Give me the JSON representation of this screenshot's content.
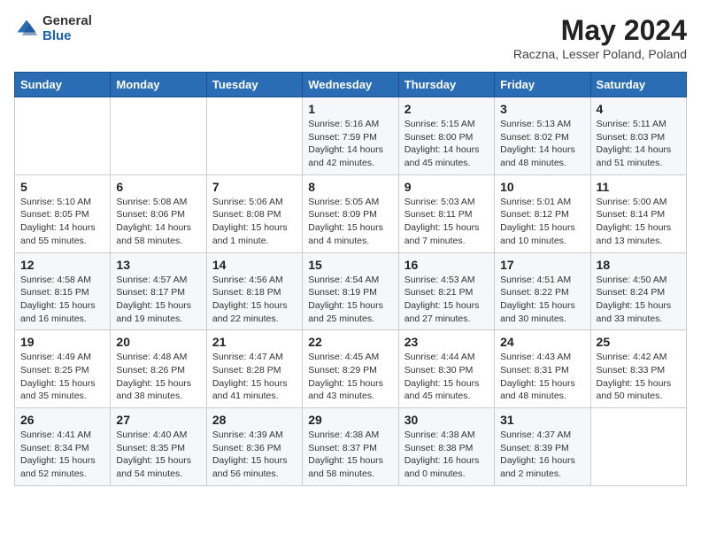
{
  "logo": {
    "general": "General",
    "blue": "Blue"
  },
  "title": "May 2024",
  "subtitle": "Raczna, Lesser Poland, Poland",
  "headers": [
    "Sunday",
    "Monday",
    "Tuesday",
    "Wednesday",
    "Thursday",
    "Friday",
    "Saturday"
  ],
  "weeks": [
    [
      {
        "day": "",
        "info": ""
      },
      {
        "day": "",
        "info": ""
      },
      {
        "day": "",
        "info": ""
      },
      {
        "day": "1",
        "info": "Sunrise: 5:16 AM\nSunset: 7:59 PM\nDaylight: 14 hours\nand 42 minutes."
      },
      {
        "day": "2",
        "info": "Sunrise: 5:15 AM\nSunset: 8:00 PM\nDaylight: 14 hours\nand 45 minutes."
      },
      {
        "day": "3",
        "info": "Sunrise: 5:13 AM\nSunset: 8:02 PM\nDaylight: 14 hours\nand 48 minutes."
      },
      {
        "day": "4",
        "info": "Sunrise: 5:11 AM\nSunset: 8:03 PM\nDaylight: 14 hours\nand 51 minutes."
      }
    ],
    [
      {
        "day": "5",
        "info": "Sunrise: 5:10 AM\nSunset: 8:05 PM\nDaylight: 14 hours\nand 55 minutes."
      },
      {
        "day": "6",
        "info": "Sunrise: 5:08 AM\nSunset: 8:06 PM\nDaylight: 14 hours\nand 58 minutes."
      },
      {
        "day": "7",
        "info": "Sunrise: 5:06 AM\nSunset: 8:08 PM\nDaylight: 15 hours\nand 1 minute."
      },
      {
        "day": "8",
        "info": "Sunrise: 5:05 AM\nSunset: 8:09 PM\nDaylight: 15 hours\nand 4 minutes."
      },
      {
        "day": "9",
        "info": "Sunrise: 5:03 AM\nSunset: 8:11 PM\nDaylight: 15 hours\nand 7 minutes."
      },
      {
        "day": "10",
        "info": "Sunrise: 5:01 AM\nSunset: 8:12 PM\nDaylight: 15 hours\nand 10 minutes."
      },
      {
        "day": "11",
        "info": "Sunrise: 5:00 AM\nSunset: 8:14 PM\nDaylight: 15 hours\nand 13 minutes."
      }
    ],
    [
      {
        "day": "12",
        "info": "Sunrise: 4:58 AM\nSunset: 8:15 PM\nDaylight: 15 hours\nand 16 minutes."
      },
      {
        "day": "13",
        "info": "Sunrise: 4:57 AM\nSunset: 8:17 PM\nDaylight: 15 hours\nand 19 minutes."
      },
      {
        "day": "14",
        "info": "Sunrise: 4:56 AM\nSunset: 8:18 PM\nDaylight: 15 hours\nand 22 minutes."
      },
      {
        "day": "15",
        "info": "Sunrise: 4:54 AM\nSunset: 8:19 PM\nDaylight: 15 hours\nand 25 minutes."
      },
      {
        "day": "16",
        "info": "Sunrise: 4:53 AM\nSunset: 8:21 PM\nDaylight: 15 hours\nand 27 minutes."
      },
      {
        "day": "17",
        "info": "Sunrise: 4:51 AM\nSunset: 8:22 PM\nDaylight: 15 hours\nand 30 minutes."
      },
      {
        "day": "18",
        "info": "Sunrise: 4:50 AM\nSunset: 8:24 PM\nDaylight: 15 hours\nand 33 minutes."
      }
    ],
    [
      {
        "day": "19",
        "info": "Sunrise: 4:49 AM\nSunset: 8:25 PM\nDaylight: 15 hours\nand 35 minutes."
      },
      {
        "day": "20",
        "info": "Sunrise: 4:48 AM\nSunset: 8:26 PM\nDaylight: 15 hours\nand 38 minutes."
      },
      {
        "day": "21",
        "info": "Sunrise: 4:47 AM\nSunset: 8:28 PM\nDaylight: 15 hours\nand 41 minutes."
      },
      {
        "day": "22",
        "info": "Sunrise: 4:45 AM\nSunset: 8:29 PM\nDaylight: 15 hours\nand 43 minutes."
      },
      {
        "day": "23",
        "info": "Sunrise: 4:44 AM\nSunset: 8:30 PM\nDaylight: 15 hours\nand 45 minutes."
      },
      {
        "day": "24",
        "info": "Sunrise: 4:43 AM\nSunset: 8:31 PM\nDaylight: 15 hours\nand 48 minutes."
      },
      {
        "day": "25",
        "info": "Sunrise: 4:42 AM\nSunset: 8:33 PM\nDaylight: 15 hours\nand 50 minutes."
      }
    ],
    [
      {
        "day": "26",
        "info": "Sunrise: 4:41 AM\nSunset: 8:34 PM\nDaylight: 15 hours\nand 52 minutes."
      },
      {
        "day": "27",
        "info": "Sunrise: 4:40 AM\nSunset: 8:35 PM\nDaylight: 15 hours\nand 54 minutes."
      },
      {
        "day": "28",
        "info": "Sunrise: 4:39 AM\nSunset: 8:36 PM\nDaylight: 15 hours\nand 56 minutes."
      },
      {
        "day": "29",
        "info": "Sunrise: 4:38 AM\nSunset: 8:37 PM\nDaylight: 15 hours\nand 58 minutes."
      },
      {
        "day": "30",
        "info": "Sunrise: 4:38 AM\nSunset: 8:38 PM\nDaylight: 16 hours\nand 0 minutes."
      },
      {
        "day": "31",
        "info": "Sunrise: 4:37 AM\nSunset: 8:39 PM\nDaylight: 16 hours\nand 2 minutes."
      },
      {
        "day": "",
        "info": ""
      }
    ]
  ]
}
